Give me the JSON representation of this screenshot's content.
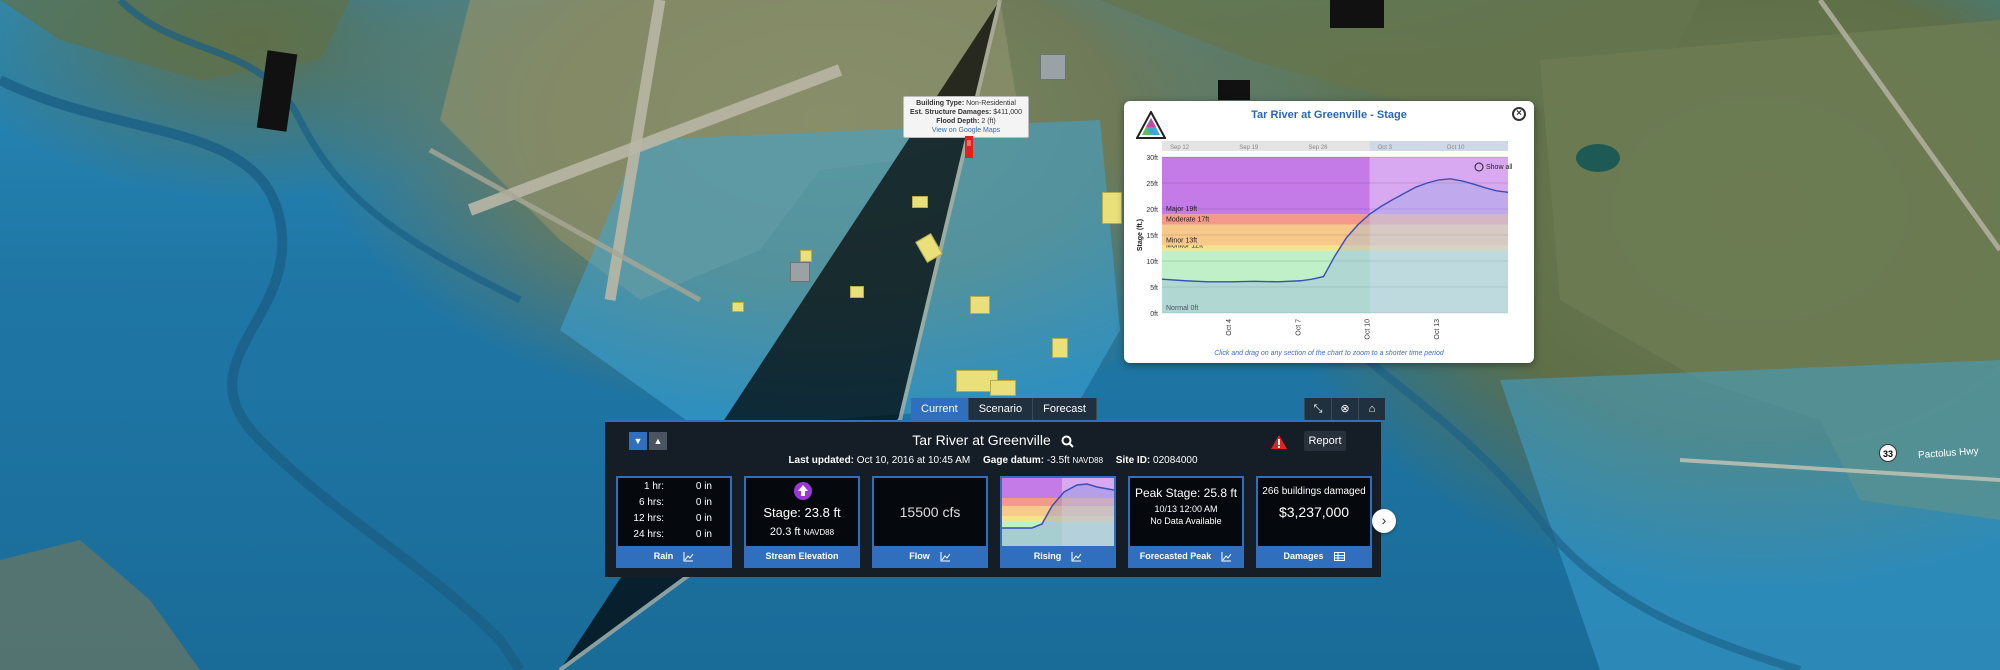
{
  "tooltip": {
    "building_type_label": "Building Type:",
    "building_type": "Non-Residential",
    "damages_label": "Est. Structure Damages:",
    "damages": "$411,000",
    "depth_label": "Flood Depth:",
    "depth": "2 (ft)",
    "link": "View on Google Maps"
  },
  "map_labels": {
    "highway_shield": "33",
    "highway_name": "Pactolus Hwy"
  },
  "chart_popup": {
    "title": "Tar River at Greenville - Stage",
    "footer": "Click and drag on any section of the chart to zoom to a shorter time period",
    "show_all": "Show all",
    "close_icon": "close-icon"
  },
  "chart_data": {
    "type": "area",
    "title": "Tar River at Greenville - Stage",
    "ylabel": "Stage (ft.)",
    "xlabel": "",
    "ylim": [
      0,
      30
    ],
    "y_ticks": [
      "0ft",
      "5ft",
      "10ft",
      "15ft",
      "20ft",
      "25ft",
      "30ft"
    ],
    "x_ticks": [
      "Oct 4",
      "Oct 7",
      "Oct 10",
      "Oct 13"
    ],
    "navigator_ticks": [
      "Sep 12",
      "Sep 19",
      "Sep 26",
      "Oct 3",
      "Oct 10"
    ],
    "x_range": [
      "Oct 1",
      "Oct 16"
    ],
    "forecast_start": "Oct 10",
    "bands": [
      {
        "name": "Normal 0ft",
        "from": 0,
        "to": 12,
        "color": "#bff0c8"
      },
      {
        "name": "Monitor 12ft",
        "from": 12,
        "to": 13,
        "color": "#f5e48a"
      },
      {
        "name": "Minor 13ft",
        "from": 13,
        "to": 17,
        "color": "#f7c98a"
      },
      {
        "name": "Moderate 17ft",
        "from": 17,
        "to": 19,
        "color": "#f59a8a"
      },
      {
        "name": "Major 19ft",
        "from": 19,
        "to": 30,
        "color": "#c47be8"
      }
    ],
    "series": [
      {
        "x": [
          1,
          2,
          3,
          4,
          5,
          6,
          7,
          7.5,
          8,
          8.5,
          9,
          9.5,
          10,
          10.5,
          11,
          11.5,
          12,
          12.5,
          13,
          13.5,
          14,
          14.5,
          15,
          15.5,
          16
        ],
        "y": [
          6.5,
          6.2,
          6.0,
          6.0,
          6.1,
          6.0,
          6.2,
          6.5,
          7.0,
          11.0,
          14.5,
          17.0,
          19.0,
          20.5,
          21.8,
          23.0,
          24.2,
          25.0,
          25.6,
          25.8,
          25.4,
          24.8,
          24.1,
          23.5,
          23.2
        ]
      }
    ]
  },
  "panel": {
    "tabs": [
      "Current",
      "Scenario",
      "Forecast"
    ],
    "station": "Tar River at Greenville",
    "last_updated_label": "Last updated:",
    "last_updated": "Oct 10, 2016 at 10:45 AM",
    "gage_datum_label": "Gage datum:",
    "gage_datum": "-3.5ft",
    "gage_datum_unit": "NAVD88",
    "site_id_label": "Site ID:",
    "site_id": "02084000",
    "report": "Report",
    "rain": {
      "rows": [
        {
          "label": "1 hr:",
          "value": "0 in"
        },
        {
          "label": "6 hrs:",
          "value": "0 in"
        },
        {
          "label": "12 hrs:",
          "value": "0 in"
        },
        {
          "label": "24 hrs:",
          "value": "0 in"
        }
      ],
      "footer": "Rain"
    },
    "stream": {
      "stage": "Stage: 23.8 ft",
      "navd": "20.3 ft",
      "navd_unit": "NAVD88",
      "footer": "Stream Elevation"
    },
    "flow": {
      "value": "15500 cfs",
      "footer": "Flow"
    },
    "trend": {
      "footer": "Rising"
    },
    "peak": {
      "title": "Peak Stage: 25.8 ft",
      "date": "10/13 12:00 AM",
      "note": "No Data Available",
      "footer": "Forecasted Peak"
    },
    "damages": {
      "buildings": "266 buildings damaged",
      "amount": "$3,237,000",
      "footer": "Damages"
    }
  }
}
